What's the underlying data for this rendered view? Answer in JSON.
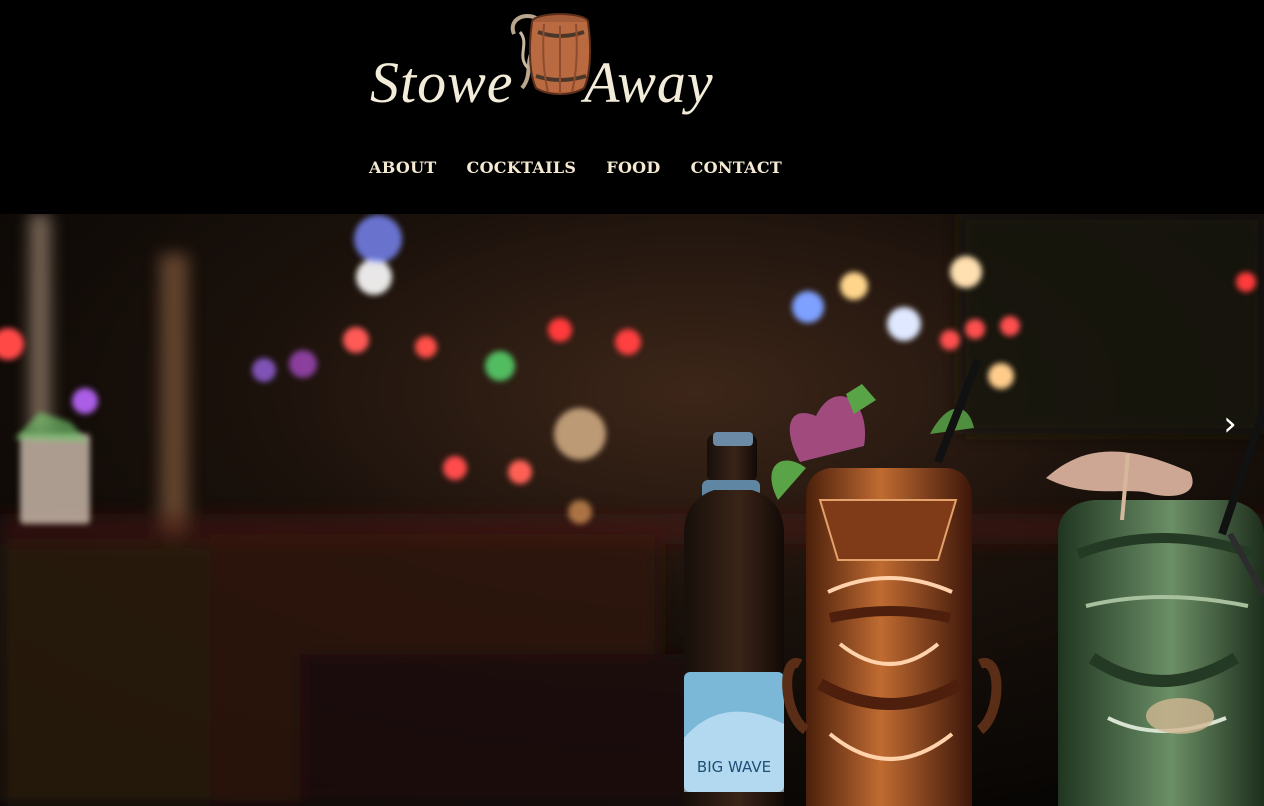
{
  "brand": {
    "name_left": "Stowe",
    "name_right": "Away",
    "logo_icon": "barrel-icon"
  },
  "nav": {
    "items": [
      {
        "label": "ABOUT"
      },
      {
        "label": "COCKTAILS"
      },
      {
        "label": "FOOD"
      },
      {
        "label": "CONTACT"
      }
    ]
  },
  "hero": {
    "next_icon": "chevron-right-icon",
    "next_symbol": "›",
    "bottle_label": "BIG WAVE"
  },
  "colors": {
    "background": "#000000",
    "nav_text": "#f4ead2",
    "accent_warm": "#8a4a22"
  }
}
